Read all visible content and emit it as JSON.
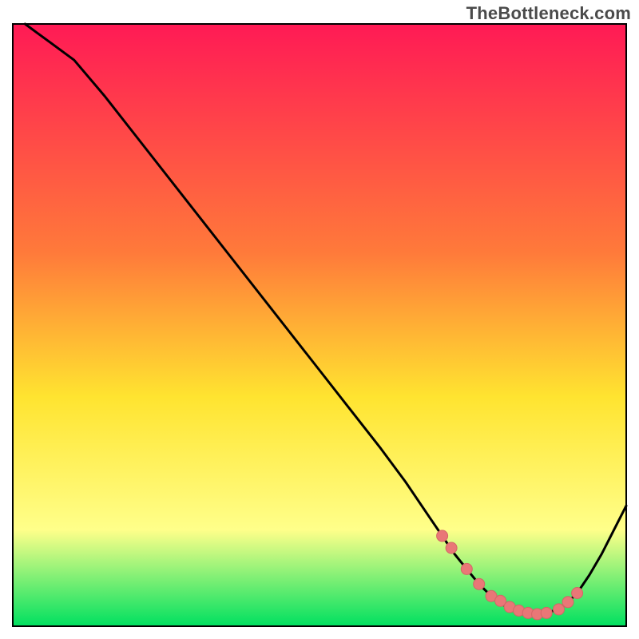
{
  "watermark": "TheBottleneck.com",
  "colors": {
    "gradient_top": "#ff1a55",
    "gradient_mid1": "#ff7a3a",
    "gradient_mid2": "#ffe430",
    "gradient_mid3": "#ffff8a",
    "gradient_bottom": "#00e060",
    "curve": "#000000",
    "marker_fill": "#e97777",
    "marker_stroke": "#d46666",
    "frame": "#000000"
  },
  "chart_data": {
    "type": "line",
    "title": "",
    "xlabel": "",
    "ylabel": "",
    "xlim": [
      0,
      100
    ],
    "ylim": [
      0,
      100
    ],
    "annotations": [],
    "series": [
      {
        "name": "bottleneck-curve",
        "x": [
          2,
          4,
          6,
          10,
          15,
          20,
          25,
          30,
          35,
          40,
          45,
          50,
          55,
          60,
          64,
          68,
          70,
          72,
          74,
          76,
          78,
          80,
          82,
          84,
          86,
          88,
          90,
          92,
          94,
          96,
          98,
          100
        ],
        "y": [
          100,
          98.5,
          97,
          94,
          88,
          81.5,
          75,
          68.5,
          62,
          55.5,
          49,
          42.5,
          36,
          29.5,
          24,
          18,
          15,
          12,
          9.5,
          7,
          5,
          3.5,
          2.5,
          2,
          2,
          2.5,
          3.5,
          5.5,
          8.5,
          12,
          16,
          20
        ]
      }
    ],
    "markers": {
      "name": "highlight-points",
      "x": [
        70,
        71.5,
        74,
        76,
        78,
        79.5,
        81,
        82.5,
        84,
        85.5,
        87,
        89,
        90.5,
        92
      ],
      "y": [
        15,
        13,
        9.5,
        7,
        5,
        4.2,
        3.2,
        2.6,
        2.2,
        2,
        2.2,
        2.8,
        4,
        5.5
      ]
    }
  }
}
